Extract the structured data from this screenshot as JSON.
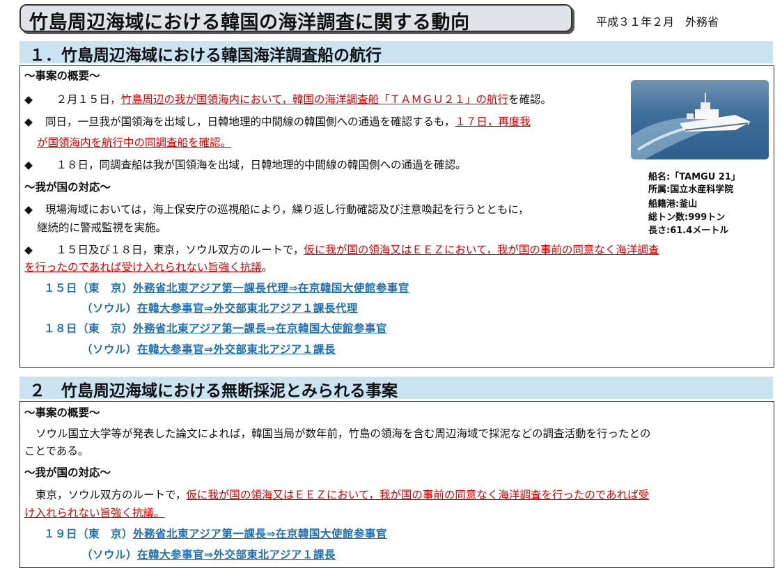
{
  "header": {
    "title": "竹島周辺海域における韓国の海洋調査に関する動向",
    "date_org": "平成３１年２月　外務省"
  },
  "section1": {
    "heading": "１．竹島周辺海域における韓国海洋調査船の航行",
    "overview_label": "～事案の概要～",
    "b1_pre": "２月１５日，",
    "b1_red": "竹島周辺の我が国領海内において，韓国の海洋調査船「ＴＡＭＧＵ２１」の航行",
    "b1_post": "を確認。",
    "b2_pre": "同日，一旦我が国領海を出域し，日韓地理的中間線の韓国側への通過を確認するも，",
    "b2_red1": "１７日，再度我",
    "b2_red2": "が国領海内を航行中の同調査船を確認。",
    "b3": "１８日，同調査船は我が国領海を出域，日韓地理的中間線の韓国側への通過を確認。",
    "response_label": "～我が国の対応～",
    "r1_line1": "現場海域においては，海上保安庁の巡視船により，繰り返し行動確認及び注意喚起を行うとともに，",
    "r1_line2": "継続的に警戒監視を実施。",
    "r2_pre": "１５日及び１８日，東京，ソウル双方のルートで，",
    "r2_red1": "仮に我が国の領海又はＥＥＺにおいて，我が国の事前の同意なく海洋調査",
    "r2_red2": "を行ったのであれば受け入れられない旨強く抗議",
    "r2_post": "。",
    "contacts": [
      {
        "prefix": "１５日（東　京）",
        "text": "外務省北東アジア第一課長代理⇒在京韓国大使館参事官"
      },
      {
        "prefix": "（ソウル）",
        "text": "在韓大参事官⇒外交部東北アジア１課長代理"
      },
      {
        "prefix": "１８日（東　京）",
        "text": "外務省北東アジア第一課長⇒在京韓国大使館参事官"
      },
      {
        "prefix": "（ソウル）",
        "text": "在韓大参事官⇒外交部東北アジア１課長"
      }
    ],
    "ship_info": [
      "船名:「TAMGU 21」",
      "所属:国立水産科学院",
      "船籍港:釜山",
      "総トン数:999トン",
      "長さ:61.4メートル"
    ]
  },
  "section2": {
    "heading": "２　竹島周辺海域における無断採泥とみられる事案",
    "overview_label": "～事案の概要～",
    "ov_line1": "ソウル国立大学等が発表した論文によれば，韓国当局が数年前，竹島の領海を含む周辺海域で採泥などの調査活動を行ったとの",
    "ov_line2": "ことである。",
    "response_label": "～我が国の対応～",
    "r_pre": "東京，ソウル双方のルートで，",
    "r_red1": "仮に我が国の領海又はＥＥＺにおいて，我が国の事前の同意なく海洋調査を行ったのであれば受",
    "r_red2": "け入れられない旨強く抗議。",
    "contacts": [
      {
        "prefix": "１９日（東　京）",
        "text": "外務省北東アジア第一課長⇒在京韓国大使館参事官"
      },
      {
        "prefix": "（ソウル）",
        "text": "在韓大参事官⇒外交部東北アジア１課長"
      }
    ]
  },
  "colors": {
    "accent_red": "#e00000",
    "link_blue": "#1f6fb2",
    "header_bg": "#c9e3f1"
  },
  "icons": {
    "bullet": "◆"
  }
}
